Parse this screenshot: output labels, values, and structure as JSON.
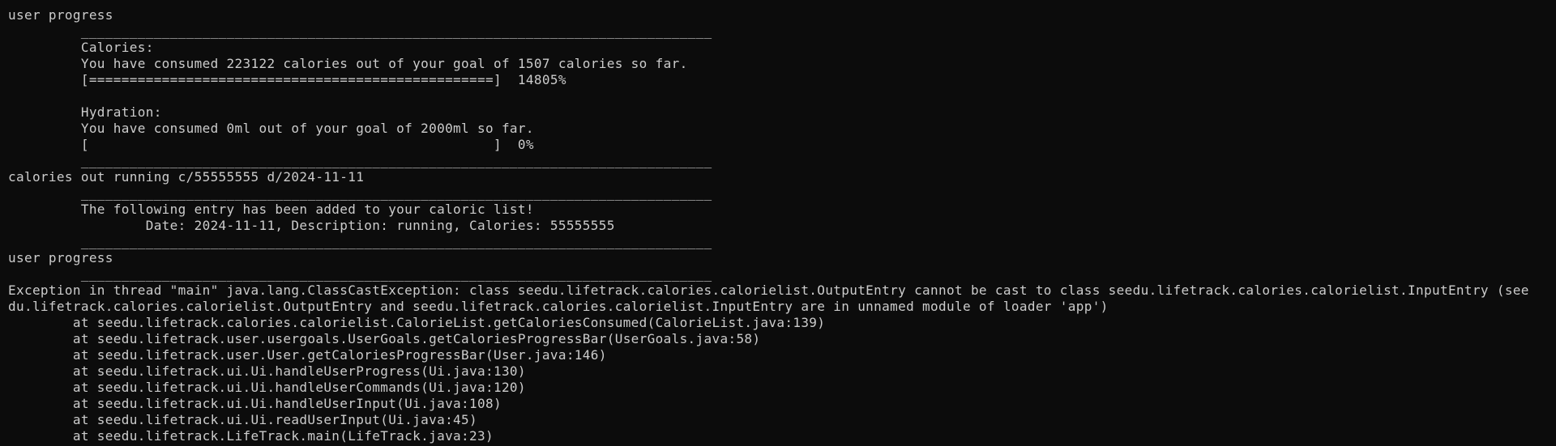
{
  "terminal": {
    "lines": [
      "user progress",
      "         ______________________________________________________________________________",
      "         Calories:",
      "         You have consumed 223122 calories out of your goal of 1507 calories so far.",
      "         [==================================================]  14805%",
      "",
      "         Hydration:",
      "         You have consumed 0ml out of your goal of 2000ml so far.",
      "         [                                                  ]  0%",
      "         ______________________________________________________________________________",
      "calories out running c/55555555 d/2024-11-11",
      "         ______________________________________________________________________________",
      "         The following entry has been added to your caloric list!",
      "                 Date: 2024-11-11, Description: running, Calories: 55555555",
      "         ______________________________________________________________________________",
      "user progress",
      "         ______________________________________________________________________________",
      "Exception in thread \"main\" java.lang.ClassCastException: class seedu.lifetrack.calories.calorielist.OutputEntry cannot be cast to class seedu.lifetrack.calories.calorielist.InputEntry (see",
      "du.lifetrack.calories.calorielist.OutputEntry and seedu.lifetrack.calories.calorielist.InputEntry are in unnamed module of loader 'app')",
      "        at seedu.lifetrack.calories.calorielist.CalorieList.getCaloriesConsumed(CalorieList.java:139)",
      "        at seedu.lifetrack.user.usergoals.UserGoals.getCaloriesProgressBar(UserGoals.java:58)",
      "        at seedu.lifetrack.user.User.getCaloriesProgressBar(User.java:146)",
      "        at seedu.lifetrack.ui.Ui.handleUserProgress(Ui.java:130)",
      "        at seedu.lifetrack.ui.Ui.handleUserCommands(Ui.java:120)",
      "        at seedu.lifetrack.ui.Ui.handleUserInput(Ui.java:108)",
      "        at seedu.lifetrack.ui.Ui.readUserInput(Ui.java:45)",
      "        at seedu.lifetrack.LifeTrack.main(LifeTrack.java:23)"
    ]
  }
}
